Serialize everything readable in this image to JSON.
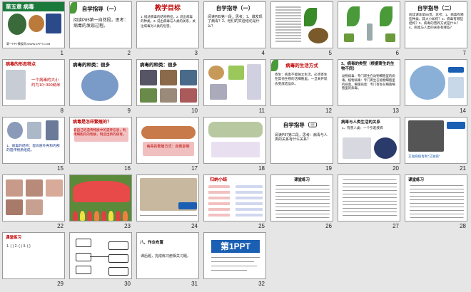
{
  "slides": [
    {
      "num": "1",
      "title": "第五章  病毒",
      "body": "第一PPT模板网-WWW.1PPT.COM"
    },
    {
      "num": "2",
      "title": "自学指导（一）",
      "body": "阅读P85第一自然段，思考：病毒的发现过程。"
    },
    {
      "num": "3",
      "title": "教学目标",
      "body": "1. 描述病毒的结构特征。2. 说出病毒的种类。3. 说出病毒与人类的关系，关注病毒对人类的危害。"
    },
    {
      "num": "4",
      "title": "自学指导（一）",
      "body": "阅读P85第一段，思考：1、谁发现了病毒？2、他们的实验结论是什么？"
    },
    {
      "num": "5",
      "title": "",
      "body": ""
    },
    {
      "num": "6",
      "title": "",
      "body": ""
    },
    {
      "num": "7",
      "title": "自学指导（二）",
      "body": "阅读课本第86页，思考：1、病毒有哪些种类，其大小如何？2、病毒有哪些结构？3、病毒的营养方式是什么？4、病毒与人类的关系有哪些？"
    },
    {
      "num": "8",
      "title": "病毒的形态特点",
      "body": "一个病毒的大小约为10~300纳米"
    },
    {
      "num": "9",
      "title": "病毒的种类：很多",
      "body": ""
    },
    {
      "num": "10",
      "title": "病毒的种类：很多",
      "body": ""
    },
    {
      "num": "11",
      "title": "",
      "body": ""
    },
    {
      "num": "12",
      "title": "病毒的生活方式",
      "body": "寄生：病毒不能独立生活，必须寄生在其他生物的活细胞里。一旦离开就会变成结晶体。"
    },
    {
      "num": "13",
      "title": "3、病毒的类型（根据寄生的生物不同）",
      "body": "动物病毒：专门寄生在动物细胞里的病毒。植物病毒：专门寄生在植物细胞里的病毒。细菌病毒：专门寄生在细菌细胞里的病毒。"
    },
    {
      "num": "14",
      "title": "",
      "body": ""
    },
    {
      "num": "15",
      "title": "",
      "body": "1、病毒的结构：蛋白质外壳和内部的遗传物质组成。"
    },
    {
      "num": "16",
      "title": "病毒是怎样繁殖的？",
      "body": "靠自己的遗传物质中的遗传信息，利用细胞内的物质，制造出新的病毒。"
    },
    {
      "num": "17",
      "title": "",
      "body": "病毒的繁殖方式：自我复制"
    },
    {
      "num": "18",
      "title": "",
      "body": ""
    },
    {
      "num": "19",
      "title": "自学指导（三）",
      "body": "阅读P87第二段，思考：病毒与人类的关系有什么关系？"
    },
    {
      "num": "20",
      "title": "病毒与人类生活的关系",
      "body": "1、有害人类：一个引起疾病"
    },
    {
      "num": "21",
      "title": "",
      "body": "艾滋病病毒和“艾滋病”"
    },
    {
      "num": "22",
      "title": "",
      "body": ""
    },
    {
      "num": "23",
      "title": "",
      "body": ""
    },
    {
      "num": "24",
      "title": "",
      "body": ""
    },
    {
      "num": "25",
      "title": "归纳小结",
      "body": ""
    },
    {
      "num": "26",
      "title": "课堂练习",
      "body": ""
    },
    {
      "num": "27",
      "title": "",
      "body": ""
    },
    {
      "num": "28",
      "title": "课堂练习",
      "body": ""
    },
    {
      "num": "29",
      "title": "课堂练习",
      "body": "1. (  ) 2. (  ) 3. (  )"
    },
    {
      "num": "30",
      "title": "",
      "body": ""
    },
    {
      "num": "31",
      "title": "八、作业布置",
      "body": "课后题，完成练习册相关习题。"
    },
    {
      "num": "32",
      "title": "第1PPT",
      "body": ""
    }
  ],
  "colors": {
    "accent_red": "#c00000",
    "accent_green": "#1a7a3c",
    "accent_blue": "#1a5fb4",
    "selection": "#3a7bd5"
  }
}
